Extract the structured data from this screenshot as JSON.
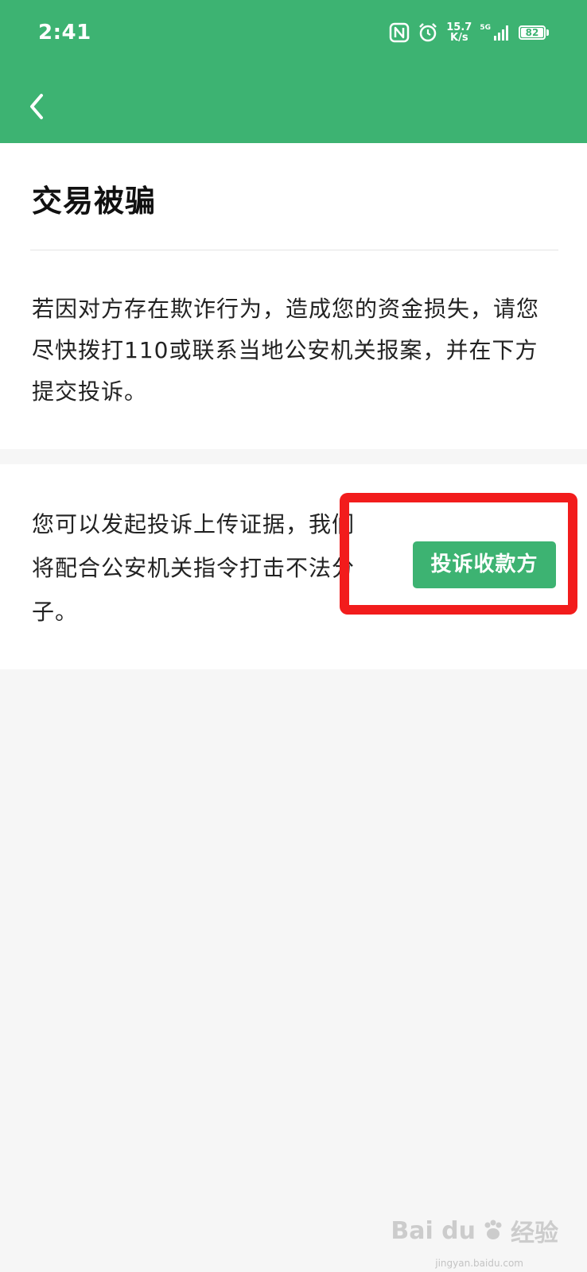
{
  "status_bar": {
    "time": "2:41",
    "speed_value": "15.7",
    "speed_unit": "K/s",
    "network": "5G",
    "battery": "82"
  },
  "colors": {
    "accent": "#3db372",
    "highlight": "#f21c1c"
  },
  "header": {
    "back_icon": "chevron-left-icon"
  },
  "page": {
    "title": "交易被骗",
    "description": "若因对方存在欺诈行为，造成您的资金损失，请您尽快拨打110或联系当地公安机关报案，并在下方提交投诉。"
  },
  "complaint": {
    "text": "您可以发起投诉上传证据，我们将配合公安机关指令打击不法分子。",
    "button_label": "投诉收款方"
  },
  "watermark": {
    "brand": "Bai du",
    "suffix": "经验",
    "site": "jingyan.baidu.com"
  }
}
